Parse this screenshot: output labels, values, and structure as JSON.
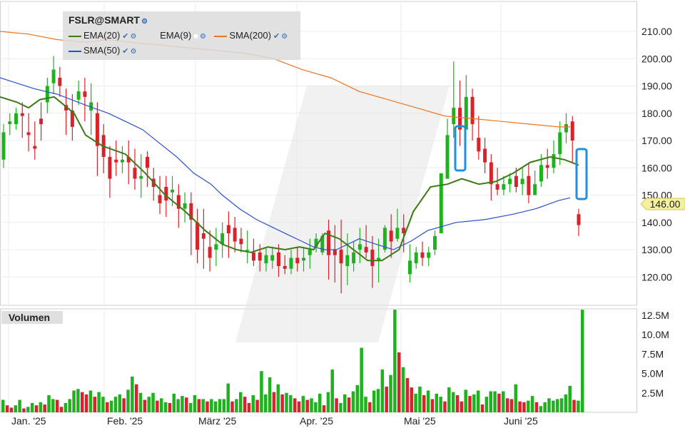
{
  "chart_data": {
    "type": "candlestick",
    "symbol": "FSLR@SMART",
    "last_price": "146.00",
    "price_axis": {
      "ticks": [
        "210.00",
        "200.00",
        "190.00",
        "180.00",
        "170.00",
        "160.00",
        "150.00",
        "140.00",
        "130.00",
        "120.00"
      ],
      "ylim": [
        110,
        220
      ]
    },
    "volume_axis": {
      "label": "Volumen",
      "ticks": [
        "12.5M",
        "10.0M",
        "7.5M",
        "5.0M",
        "2.5M"
      ],
      "ylim": [
        0,
        13.5
      ]
    },
    "x_labels": [
      "Jan. '25",
      "Feb. '25",
      "März '25",
      "Apr. '25",
      "Mai '25",
      "Juni '25"
    ],
    "indicators": [
      {
        "name": "EMA(20)",
        "color": "#3d7a17"
      },
      {
        "name": "EMA(9)",
        "color": "#e0e0e0"
      },
      {
        "name": "SMA(200)",
        "color": "#ee7420"
      },
      {
        "name": "SMA(50)",
        "color": "#2b4fd1"
      }
    ],
    "candles": [
      [
        163,
        176,
        173,
        160
      ],
      [
        176,
        180,
        177,
        172
      ],
      [
        176,
        182,
        180,
        174
      ],
      [
        180,
        184,
        179,
        171
      ],
      [
        173,
        180,
        172,
        166
      ],
      [
        168,
        177,
        167,
        163
      ],
      [
        178,
        184,
        176,
        170
      ],
      [
        184,
        193,
        190,
        180
      ],
      [
        191,
        201,
        196,
        187
      ],
      [
        193,
        197,
        190,
        186
      ],
      [
        183,
        189,
        181,
        172
      ],
      [
        181,
        187,
        175,
        170
      ],
      [
        185,
        192,
        188,
        183
      ],
      [
        188,
        193,
        186,
        177
      ],
      [
        181,
        191,
        184,
        172
      ],
      [
        180,
        184,
        168,
        157
      ],
      [
        172,
        176,
        164,
        158
      ],
      [
        164,
        168,
        156,
        149
      ],
      [
        163,
        170,
        162,
        157
      ],
      [
        162,
        168,
        163,
        158
      ],
      [
        164,
        170,
        162,
        154
      ],
      [
        160,
        167,
        156,
        152
      ],
      [
        156,
        165,
        157,
        149
      ],
      [
        164,
        166,
        160,
        153
      ],
      [
        156,
        160,
        153,
        148
      ],
      [
        150,
        157,
        147,
        143
      ],
      [
        153,
        157,
        148,
        142
      ],
      [
        151,
        157,
        152,
        146
      ],
      [
        150,
        154,
        145,
        138
      ],
      [
        145,
        151,
        147,
        140
      ],
      [
        147,
        151,
        141,
        128
      ],
      [
        140,
        145,
        130,
        125
      ],
      [
        136,
        145,
        134,
        123
      ],
      [
        131,
        137,
        127,
        122
      ],
      [
        130,
        138,
        132,
        124
      ],
      [
        132,
        140,
        136,
        127
      ],
      [
        139,
        144,
        136,
        127
      ],
      [
        138,
        142,
        133,
        129
      ],
      [
        134,
        138,
        132,
        129
      ],
      [
        130,
        137,
        130,
        125
      ],
      [
        129,
        134,
        126,
        124
      ],
      [
        129,
        132,
        126,
        122
      ],
      [
        125,
        131,
        128,
        122
      ],
      [
        126,
        131,
        128,
        123
      ],
      [
        129,
        132,
        124,
        120
      ],
      [
        124,
        128,
        123,
        121
      ],
      [
        123,
        130,
        127,
        121
      ],
      [
        127,
        131,
        125,
        122
      ],
      [
        126,
        131,
        127,
        122
      ],
      [
        128,
        134,
        130,
        123
      ],
      [
        131,
        136,
        134,
        129
      ],
      [
        129,
        136,
        135,
        128
      ],
      [
        137,
        141,
        128,
        119
      ],
      [
        130,
        139,
        128,
        118
      ],
      [
        130,
        141,
        125,
        114
      ],
      [
        124,
        136,
        128,
        117
      ],
      [
        125,
        133,
        129,
        122
      ],
      [
        130,
        138,
        132,
        125
      ],
      [
        131,
        139,
        129,
        127
      ],
      [
        130,
        135,
        124,
        116
      ],
      [
        126,
        134,
        127,
        118
      ],
      [
        130,
        139,
        138,
        129
      ],
      [
        137,
        143,
        133,
        127
      ],
      [
        134,
        145,
        138,
        133
      ],
      [
        138,
        143,
        136,
        129
      ],
      [
        121,
        132,
        126,
        118
      ],
      [
        125,
        131,
        129,
        123
      ],
      [
        129,
        133,
        127,
        124
      ],
      [
        127,
        131,
        129,
        124
      ],
      [
        130,
        137,
        135,
        128
      ],
      [
        136,
        151,
        158,
        148
      ],
      [
        156,
        178,
        172,
        158
      ],
      [
        176,
        199,
        182,
        171
      ],
      [
        182,
        192,
        174,
        168
      ],
      [
        174,
        194,
        186,
        179
      ],
      [
        186,
        189,
        176,
        170
      ],
      [
        171,
        179,
        166,
        163
      ],
      [
        167,
        171,
        162,
        158
      ],
      [
        162,
        165,
        154,
        148
      ],
      [
        154,
        160,
        152,
        150
      ],
      [
        152,
        157,
        154,
        150
      ],
      [
        154,
        158,
        156,
        151
      ],
      [
        157,
        160,
        153,
        151
      ],
      [
        154,
        160,
        156,
        150
      ],
      [
        157,
        162,
        150,
        147
      ],
      [
        150,
        159,
        154,
        151
      ],
      [
        155,
        165,
        161,
        153
      ],
      [
        161,
        167,
        160,
        156
      ],
      [
        160,
        170,
        165,
        158
      ],
      [
        165,
        177,
        173,
        161
      ],
      [
        173,
        180,
        176,
        169
      ],
      [
        177,
        179,
        170,
        162
      ],
      [
        143,
        145,
        139,
        135
      ]
    ],
    "volume": [
      1.6,
      0.9,
      0.6,
      0.9,
      1.6,
      0.5,
      0.7,
      1.2,
      0.9,
      1.3,
      1.0,
      2.2,
      1.7,
      1.6,
      0.7,
      1.2,
      1.7,
      2.8,
      3.0,
      2.6,
      2.3,
      2.8,
      2.0,
      2.6,
      2.0,
      1.3,
      1.5,
      2.0,
      2.3,
      1.8,
      2.9,
      4.6,
      3.6,
      2.5,
      1.6,
      2.0,
      2.5,
      1.5,
      1.8,
      1.3,
      1.2,
      2.4,
      1.7,
      2.1,
      1.9,
      1.2,
      2.2,
      1.7,
      1.7,
      1.4,
      1.7,
      1.4,
      1.7,
      1.7,
      3.7,
      1.4,
      1.7,
      2.6,
      2.0,
      1.2,
      2.2,
      1.6,
      5.3,
      2.3,
      4.5,
      2.6,
      3.6,
      2.3,
      2.5,
      2.2,
      1.8,
      1.4,
      2.1,
      1.6,
      1.8,
      1.3,
      2.4,
      0.9,
      2.6,
      5.5,
      1.8,
      1.2,
      2.3,
      1.9,
      2.7,
      3.5,
      8.3,
      2.0,
      1.3,
      2.8,
      3.0,
      5.5,
      3.3,
      4.8,
      13.2,
      7.7,
      5.8,
      4.4,
      3.2,
      2.4,
      3.3,
      2.2,
      2.8,
      1.7,
      2.4,
      2.0,
      1.4,
      3.2,
      2.6,
      2.2,
      1.4,
      2.9,
      2.1,
      2.3,
      2.8,
      1.0,
      2.0,
      2.7,
      2.7,
      2.4,
      2.7,
      1.8,
      1.7,
      3.6,
      1.4,
      1.3,
      1.5,
      2.1,
      1.3,
      0.8,
      1.3,
      1.8,
      1.5,
      1.7,
      1.8,
      2.3,
      3.4,
      1.6,
      1.5,
      13.2
    ],
    "ema20": [
      [
        0,
        186
      ],
      [
        0.06,
        184
      ],
      [
        0.1,
        182
      ],
      [
        0.14,
        185
      ],
      [
        0.19,
        186
      ],
      [
        0.26,
        180
      ],
      [
        0.3,
        172
      ],
      [
        0.36,
        168
      ],
      [
        0.44,
        165
      ],
      [
        0.51,
        158
      ],
      [
        0.58,
        150
      ],
      [
        0.65,
        144
      ],
      [
        0.72,
        137
      ],
      [
        0.78,
        132
      ],
      [
        0.83,
        130
      ],
      [
        0.88,
        129
      ],
      [
        0.94,
        131
      ],
      [
        1.0,
        130
      ],
      [
        1.05,
        131
      ],
      [
        1.1,
        130
      ],
      [
        1.14,
        136
      ],
      [
        1.19,
        134
      ],
      [
        1.24,
        130
      ],
      [
        1.29,
        126
      ],
      [
        1.34,
        126
      ],
      [
        1.4,
        130
      ],
      [
        1.45,
        144
      ],
      [
        1.51,
        153
      ],
      [
        1.57,
        154
      ],
      [
        1.62,
        156
      ],
      [
        1.68,
        154
      ],
      [
        1.74,
        155
      ],
      [
        1.8,
        158
      ],
      [
        1.86,
        162
      ],
      [
        1.93,
        164
      ],
      [
        1.98,
        163
      ],
      [
        2.03,
        161
      ]
    ],
    "sma50": [
      [
        0,
        193
      ],
      [
        0.06,
        191
      ],
      [
        0.12,
        189
      ],
      [
        0.2,
        187
      ],
      [
        0.3,
        183
      ],
      [
        0.38,
        180
      ],
      [
        0.44,
        177
      ],
      [
        0.5,
        174
      ],
      [
        0.56,
        169
      ],
      [
        0.62,
        164
      ],
      [
        0.68,
        158
      ],
      [
        0.74,
        154
      ],
      [
        0.78,
        150
      ],
      [
        0.84,
        145
      ],
      [
        0.9,
        141
      ],
      [
        0.96,
        138
      ],
      [
        1.02,
        135
      ],
      [
        1.06,
        133
      ],
      [
        1.1,
        131
      ],
      [
        1.14,
        130
      ],
      [
        1.18,
        130
      ],
      [
        1.22,
        132
      ],
      [
        1.26,
        134
      ],
      [
        1.32,
        132
      ],
      [
        1.38,
        130
      ],
      [
        1.44,
        133
      ],
      [
        1.5,
        137
      ],
      [
        1.6,
        140
      ],
      [
        1.7,
        141
      ],
      [
        1.8,
        143
      ],
      [
        1.88,
        145
      ],
      [
        1.96,
        148
      ],
      [
        2.0,
        149
      ]
    ],
    "sma200": [
      [
        0,
        210
      ],
      [
        0.1,
        209
      ],
      [
        0.2,
        207
      ],
      [
        0.3,
        206
      ],
      [
        0.38,
        207
      ],
      [
        0.46,
        206
      ],
      [
        0.56,
        205
      ],
      [
        0.66,
        204
      ],
      [
        0.76,
        203
      ],
      [
        0.86,
        202
      ],
      [
        0.96,
        200
      ],
      [
        1.06,
        196
      ],
      [
        1.16,
        193
      ],
      [
        1.26,
        188
      ],
      [
        1.36,
        185
      ],
      [
        1.46,
        182
      ],
      [
        1.56,
        179
      ],
      [
        1.66,
        178
      ],
      [
        1.76,
        177
      ],
      [
        1.86,
        176
      ],
      [
        1.96,
        175
      ],
      [
        2.0,
        175
      ]
    ]
  }
}
